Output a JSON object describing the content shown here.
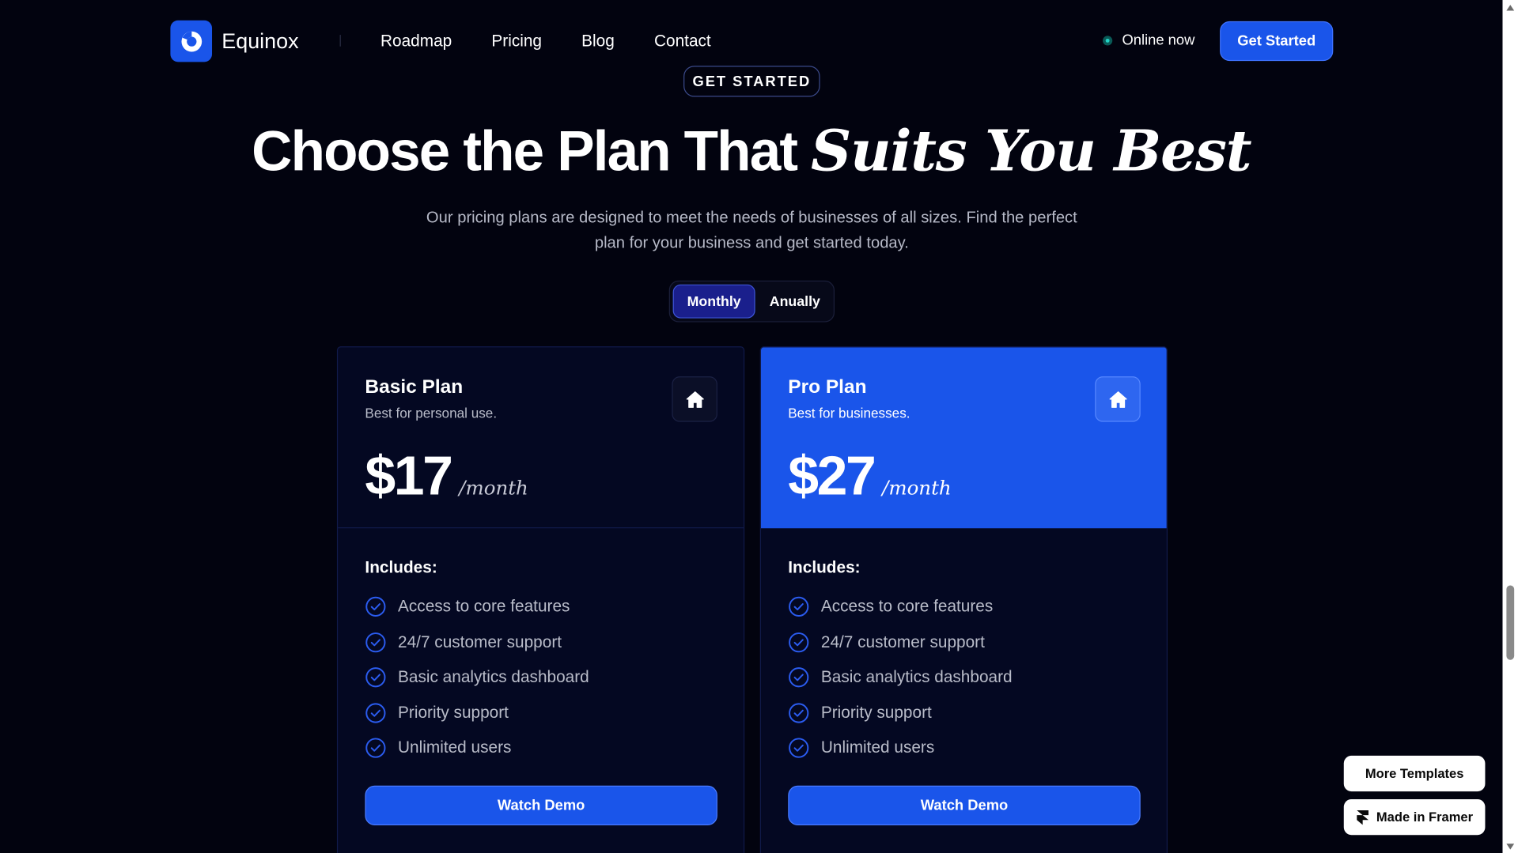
{
  "nav": {
    "brand": "Equinox",
    "links": [
      "Roadmap",
      "Pricing",
      "Blog",
      "Contact"
    ],
    "status": "Online now",
    "cta": "Get Started"
  },
  "hero": {
    "badge": "GET STARTED",
    "title_plain": "Choose the Plan That",
    "title_italic": "Suits You Best",
    "subtitle": "Our pricing plans are designed to meet the needs of businesses of all sizes. Find the perfect plan for your business and get started today."
  },
  "billing_toggle": {
    "options": [
      "Monthly",
      "Anually"
    ],
    "selected": "Monthly"
  },
  "plans": [
    {
      "name": "Basic Plan",
      "description": "Best for personal use.",
      "price": "$17",
      "period": "/month",
      "icon": "home-icon",
      "includes_label": "Includes:",
      "features": [
        "Access to core features",
        "24/7 customer support",
        "Basic analytics dashboard",
        "Priority support",
        "Unlimited users"
      ],
      "cta": "Watch Demo"
    },
    {
      "name": "Pro Plan",
      "description": "Best for businesses.",
      "price": "$27",
      "period": "/month",
      "icon": "home-icon",
      "includes_label": "Includes:",
      "features": [
        "Access to core features",
        "24/7 customer support",
        "Basic analytics dashboard",
        "Priority support",
        "Unlimited users"
      ],
      "cta": "Watch Demo"
    }
  ],
  "floating": {
    "more_templates": "More Templates",
    "made_in_framer": "Made in Framer"
  },
  "colors": {
    "background": "#02030f",
    "accent": "#1a55ea",
    "card": "#040822",
    "toggle_active": "#1a1f8c",
    "online_dot": "#22d3c5"
  }
}
